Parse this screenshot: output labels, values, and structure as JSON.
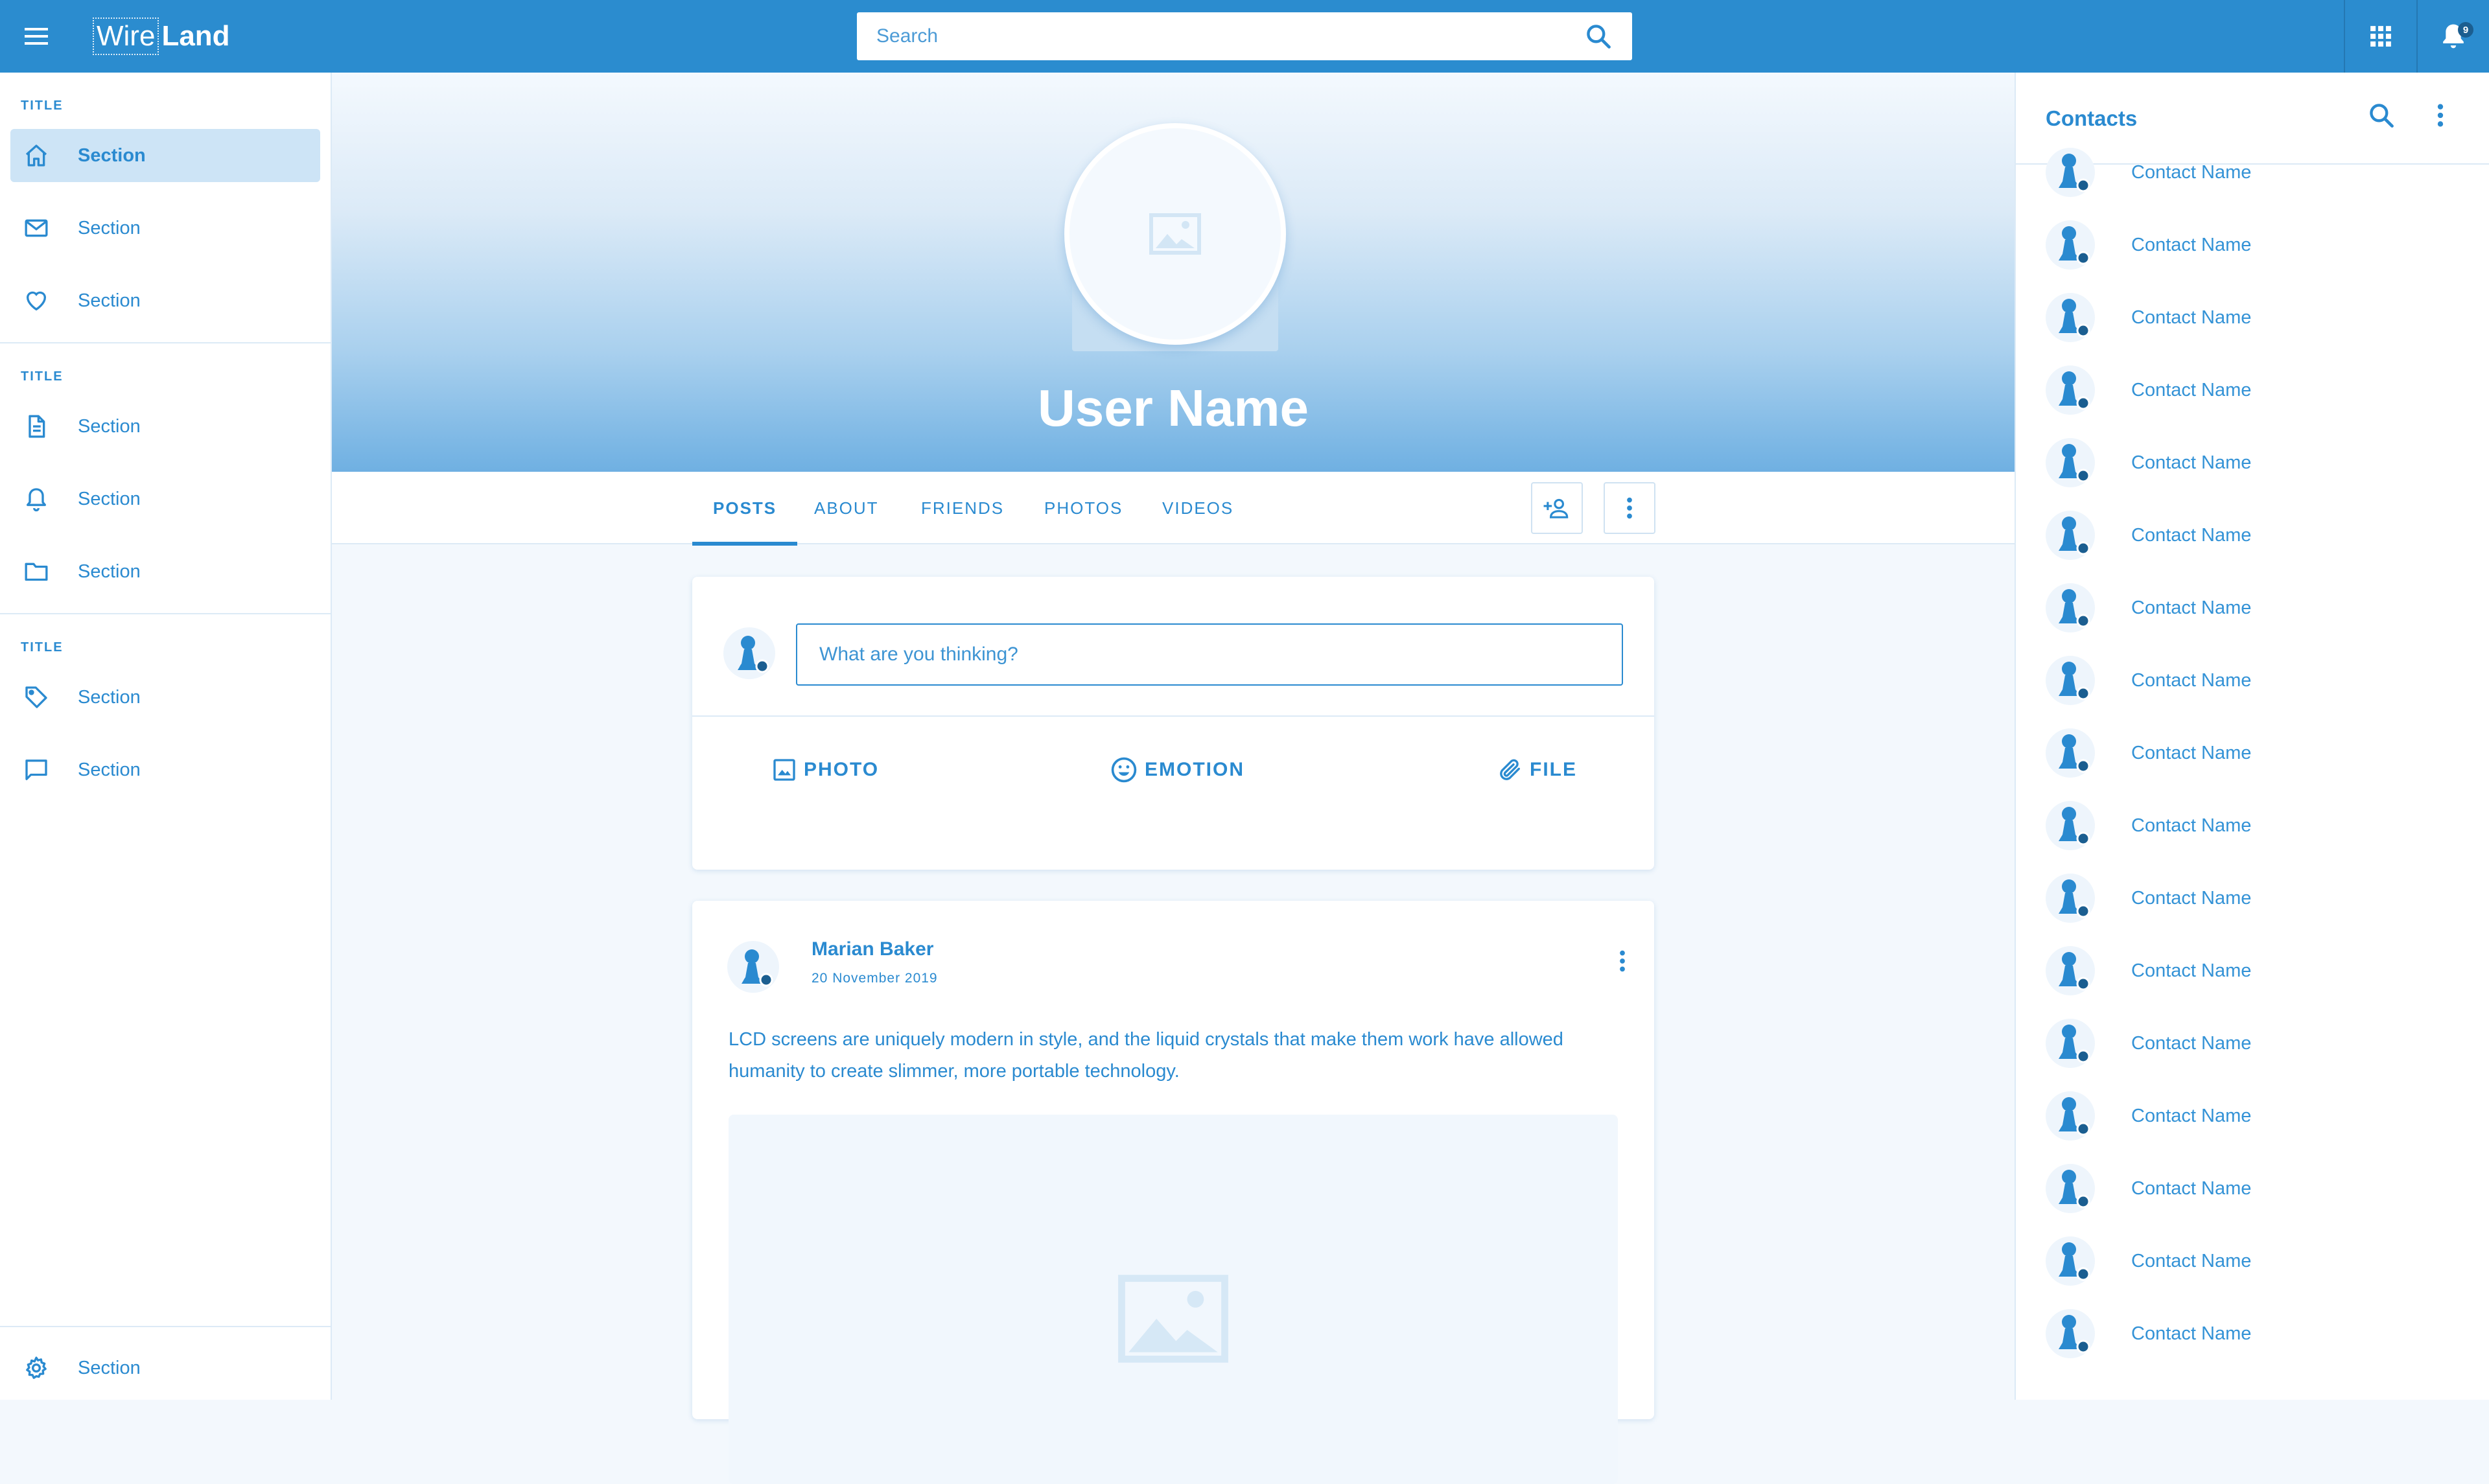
{
  "header": {
    "logo_left": "Wire",
    "logo_right": "Land",
    "search_placeholder": "Search",
    "notification_count": "9"
  },
  "sidebar": {
    "groups": [
      {
        "title": "TITLE",
        "items": [
          {
            "label": "Section",
            "icon": "home-icon",
            "active": true
          },
          {
            "label": "Section",
            "icon": "mail-icon"
          },
          {
            "label": "Section",
            "icon": "heart-icon"
          }
        ]
      },
      {
        "title": "TITLE",
        "items": [
          {
            "label": "Section",
            "icon": "document-icon"
          },
          {
            "label": "Section",
            "icon": "bell-icon"
          },
          {
            "label": "Section",
            "icon": "folder-icon"
          }
        ]
      },
      {
        "title": "TITLE",
        "items": [
          {
            "label": "Section",
            "icon": "tag-icon"
          },
          {
            "label": "Section",
            "icon": "chat-icon"
          }
        ]
      }
    ],
    "footer_item": {
      "label": "Section",
      "icon": "gear-icon"
    }
  },
  "profile": {
    "user_name": "User Name",
    "tabs": [
      "POSTS",
      "ABOUT",
      "FRIENDS",
      "PHOTOS",
      "VIDEOS"
    ],
    "active_tab": "POSTS"
  },
  "composer": {
    "placeholder": "What are you thinking?",
    "actions": [
      "PHOTO",
      "EMOTION",
      "FILE"
    ]
  },
  "post": {
    "author": "Marian Baker",
    "date": "20 November 2019",
    "text": "LCD screens are uniquely modern in style, and the liquid crystals that make them work have allowed humanity to create slimmer, more portable technology."
  },
  "contacts": {
    "title": "Contacts",
    "items": [
      "Contact Name",
      "Contact Name",
      "Contact Name",
      "Contact Name",
      "Contact Name",
      "Contact Name",
      "Contact Name",
      "Contact Name",
      "Contact Name",
      "Contact Name",
      "Contact Name",
      "Contact Name",
      "Contact Name",
      "Contact Name",
      "Contact Name",
      "Contact Name",
      "Contact Name"
    ]
  },
  "colors": {
    "primary": "#2b8ccf",
    "text": "#2a8ad0",
    "active_bg": "#cde4f6",
    "status_dot": "#1b5e90"
  }
}
